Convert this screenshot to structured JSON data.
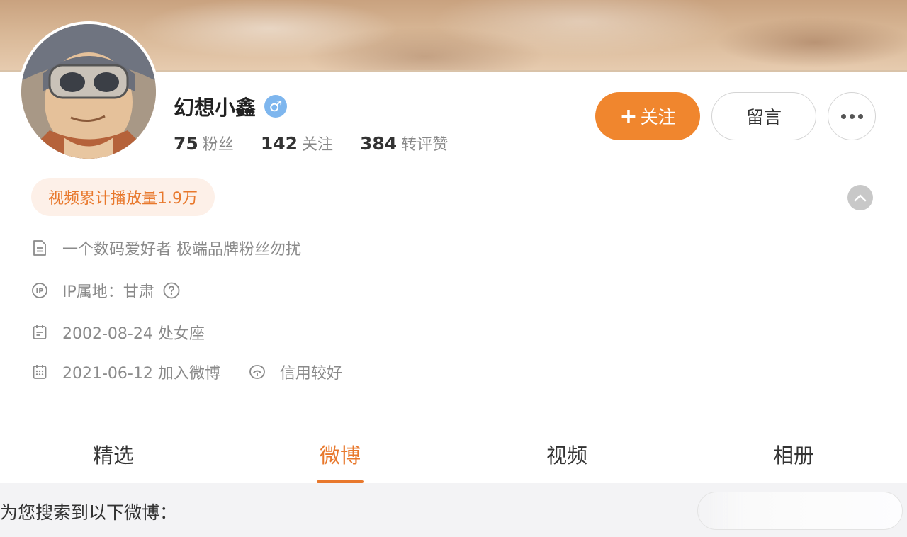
{
  "profile": {
    "name": "幻想小鑫",
    "gender_symbol": "♂",
    "stats": [
      {
        "num": "75",
        "label": "粉丝"
      },
      {
        "num": "142",
        "label": "关注"
      },
      {
        "num": "384",
        "label": "转评赞"
      }
    ]
  },
  "actions": {
    "follow_plus": "+",
    "follow_label": "关注",
    "message_label": "留言"
  },
  "video_badge": "视频累计播放量1.9万",
  "info": {
    "bio": "一个数码爱好者 极端品牌粉丝勿扰",
    "ip": "IP属地：甘肃",
    "birthday": "2002-08-24 处女座",
    "joined": "2021-06-12 加入微博",
    "credit": "信用较好"
  },
  "tabs": [
    {
      "label": "精选",
      "active": false
    },
    {
      "label": "微博",
      "active": true
    },
    {
      "label": "视频",
      "active": false
    },
    {
      "label": "相册",
      "active": false
    }
  ],
  "results_title": "为您搜索到以下微博：",
  "colors": {
    "accent": "#f0862e",
    "accent_text": "#e8782c",
    "badge_bg": "#fdf0e8",
    "gender_badge": "#7eb6ee"
  },
  "icons": [
    "document-icon",
    "ip-icon",
    "help-icon",
    "calendar-icon",
    "calendar-grid-icon",
    "credit-icon",
    "chevron-up-icon",
    "more-icon"
  ]
}
